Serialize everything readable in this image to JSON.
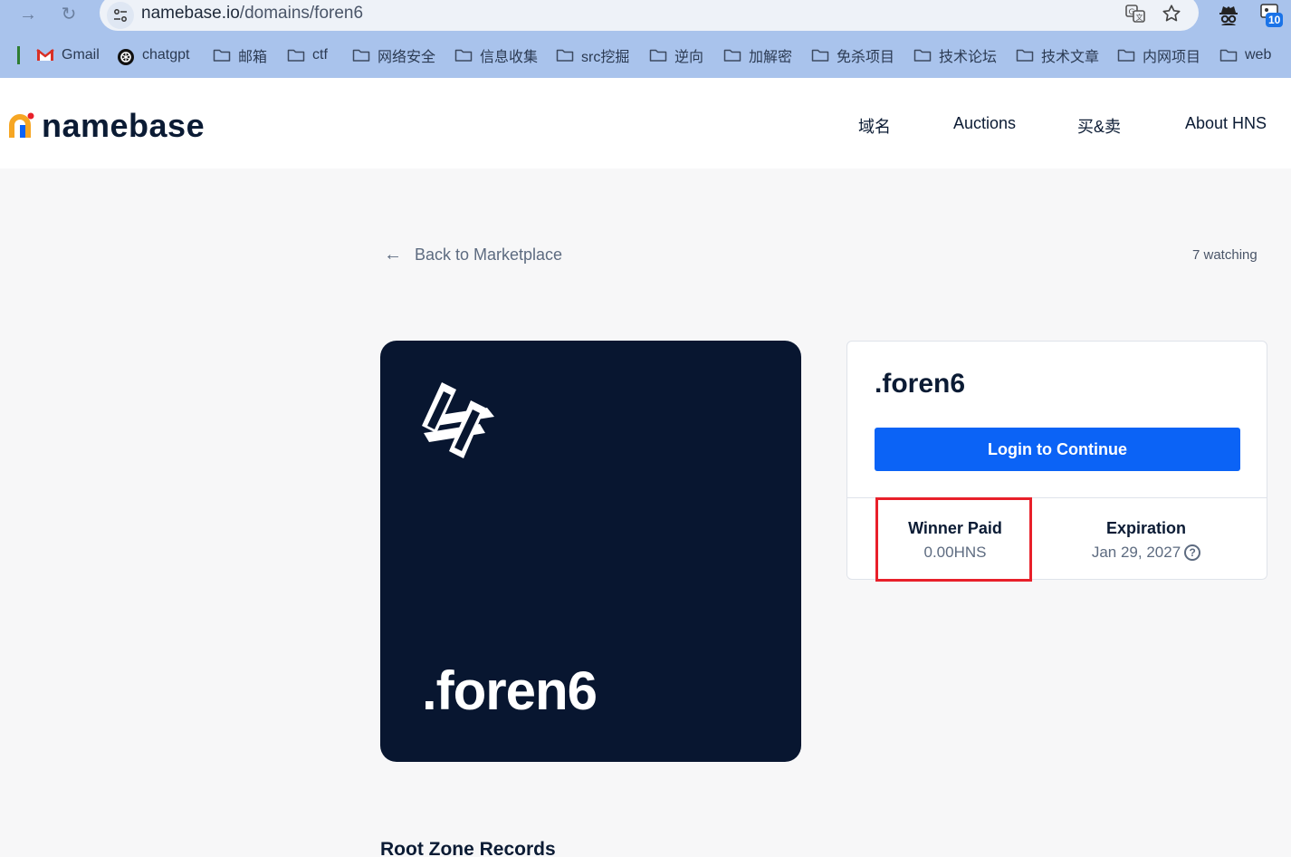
{
  "browser": {
    "url_host": "namebase.io",
    "url_path": "/domains/foren6",
    "extension_badge": "10",
    "bookmarks": [
      {
        "label": "Gmail",
        "icon": "gmail-icon"
      },
      {
        "label": "chatgpt",
        "icon": "chatgpt-icon"
      },
      {
        "label": "邮箱",
        "icon": "folder-icon"
      },
      {
        "label": "ctf",
        "icon": "folder-icon"
      },
      {
        "label": "网络安全",
        "icon": "folder-icon"
      },
      {
        "label": "信息收集",
        "icon": "folder-icon"
      },
      {
        "label": "src挖掘",
        "icon": "folder-icon"
      },
      {
        "label": "逆向",
        "icon": "folder-icon"
      },
      {
        "label": "加解密",
        "icon": "folder-icon"
      },
      {
        "label": "免杀项目",
        "icon": "folder-icon"
      },
      {
        "label": "技术论坛",
        "icon": "folder-icon"
      },
      {
        "label": "技术文章",
        "icon": "folder-icon"
      },
      {
        "label": "内网项目",
        "icon": "folder-icon"
      },
      {
        "label": "web",
        "icon": "folder-icon"
      }
    ]
  },
  "header": {
    "logo_text": "namebase",
    "nav": [
      "域名",
      "Auctions",
      "买&卖",
      "About HNS"
    ]
  },
  "main": {
    "back_label": "Back to Marketplace",
    "watching": "7 watching",
    "art_name": ".foren6",
    "domain_name": ".foren6",
    "login_label": "Login to Continue",
    "winner_paid_label": "Winner Paid",
    "winner_paid_value": "0.00HNS",
    "expiration_label": "Expiration",
    "expiration_value": "Jan 29, 2027",
    "section_title": "Root Zone Records"
  },
  "colors": {
    "primary": "#0b63f6",
    "card_bg": "#081630",
    "highlight": "#e8202a",
    "brand_orange": "#f6a623"
  }
}
